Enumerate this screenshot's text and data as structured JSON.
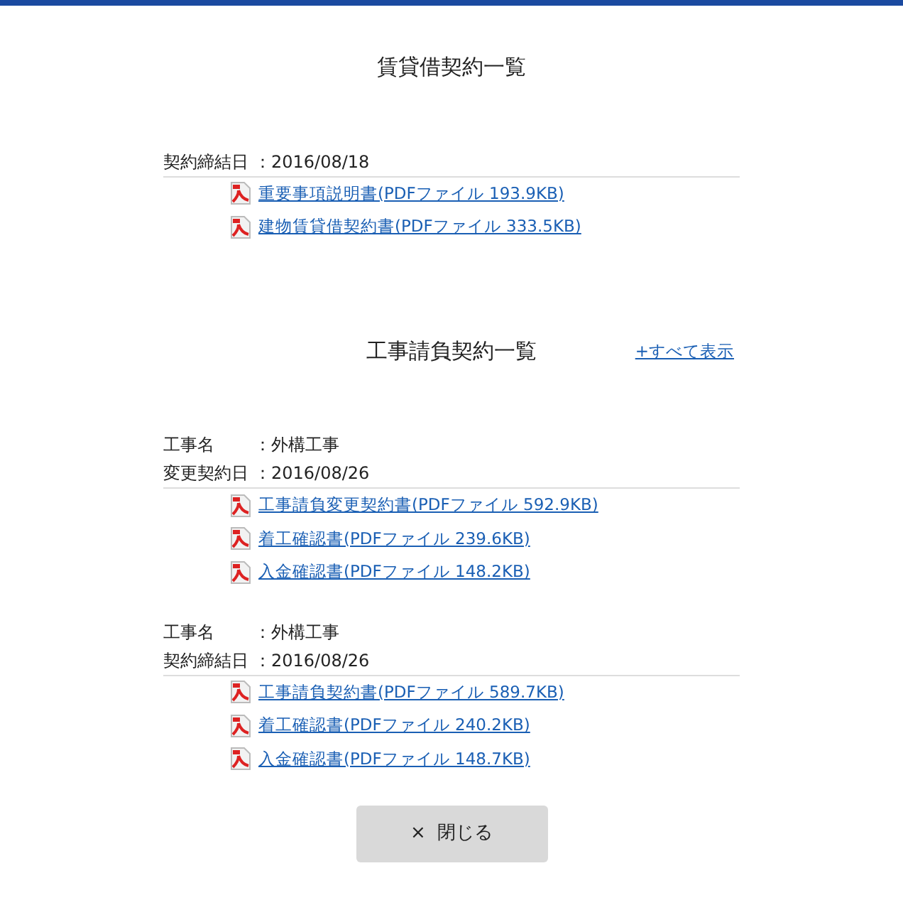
{
  "sections": [
    {
      "title": "賃貸借契約一覧",
      "groups": [
        {
          "fields": [
            {
              "label": "契約締結日",
              "colon": "：",
              "value": "2016/08/18"
            }
          ],
          "files": [
            "重要事項説明書(PDFファイル 193.9KB)",
            "建物賃貸借契約書(PDFファイル 333.5KB)"
          ]
        }
      ]
    },
    {
      "title": "工事請負契約一覧",
      "show_all": "+すべて表示",
      "groups": [
        {
          "fields": [
            {
              "label": "工事名",
              "colon": "：",
              "value": "外構工事"
            },
            {
              "label": "変更契約日",
              "colon": "：",
              "value": "2016/08/26"
            }
          ],
          "files": [
            "工事請負変更契約書(PDFファイル 592.9KB)",
            "着工確認書(PDFファイル 239.6KB)",
            "入金確認書(PDFファイル 148.2KB)"
          ]
        },
        {
          "fields": [
            {
              "label": "工事名",
              "colon": "：",
              "value": "外構工事"
            },
            {
              "label": "契約締結日",
              "colon": "：",
              "value": "2016/08/26"
            }
          ],
          "files": [
            "工事請負契約書(PDFファイル 589.7KB)",
            "着工確認書(PDFファイル 240.2KB)",
            "入金確認書(PDFファイル 148.7KB)"
          ]
        }
      ]
    }
  ],
  "close_button": {
    "icon": "×",
    "label": "閉じる"
  }
}
